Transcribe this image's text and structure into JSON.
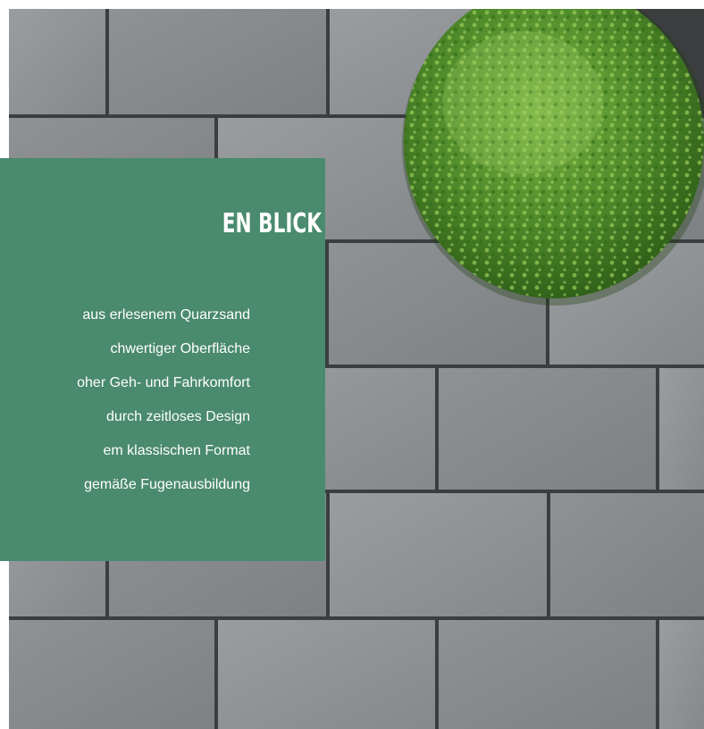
{
  "panel": {
    "title": "EN BLICK",
    "features": [
      "aus erlesenem Quarzsand",
      "chwertiger Oberfläche",
      "oher Geh- und Fahrkomfort",
      "durch zeitloses Design",
      "em klassischen Format",
      "gemäße Fugenausbildung"
    ]
  },
  "colors": {
    "panel_green": "#4a8a6f",
    "paver_gray": "#8c8f92",
    "joint_dark": "#3b3d3f",
    "shrub_green": "#4f8a2a"
  },
  "photo": {
    "subject": "gray rectangular concrete paving slabs with a round boxwood shrub"
  }
}
